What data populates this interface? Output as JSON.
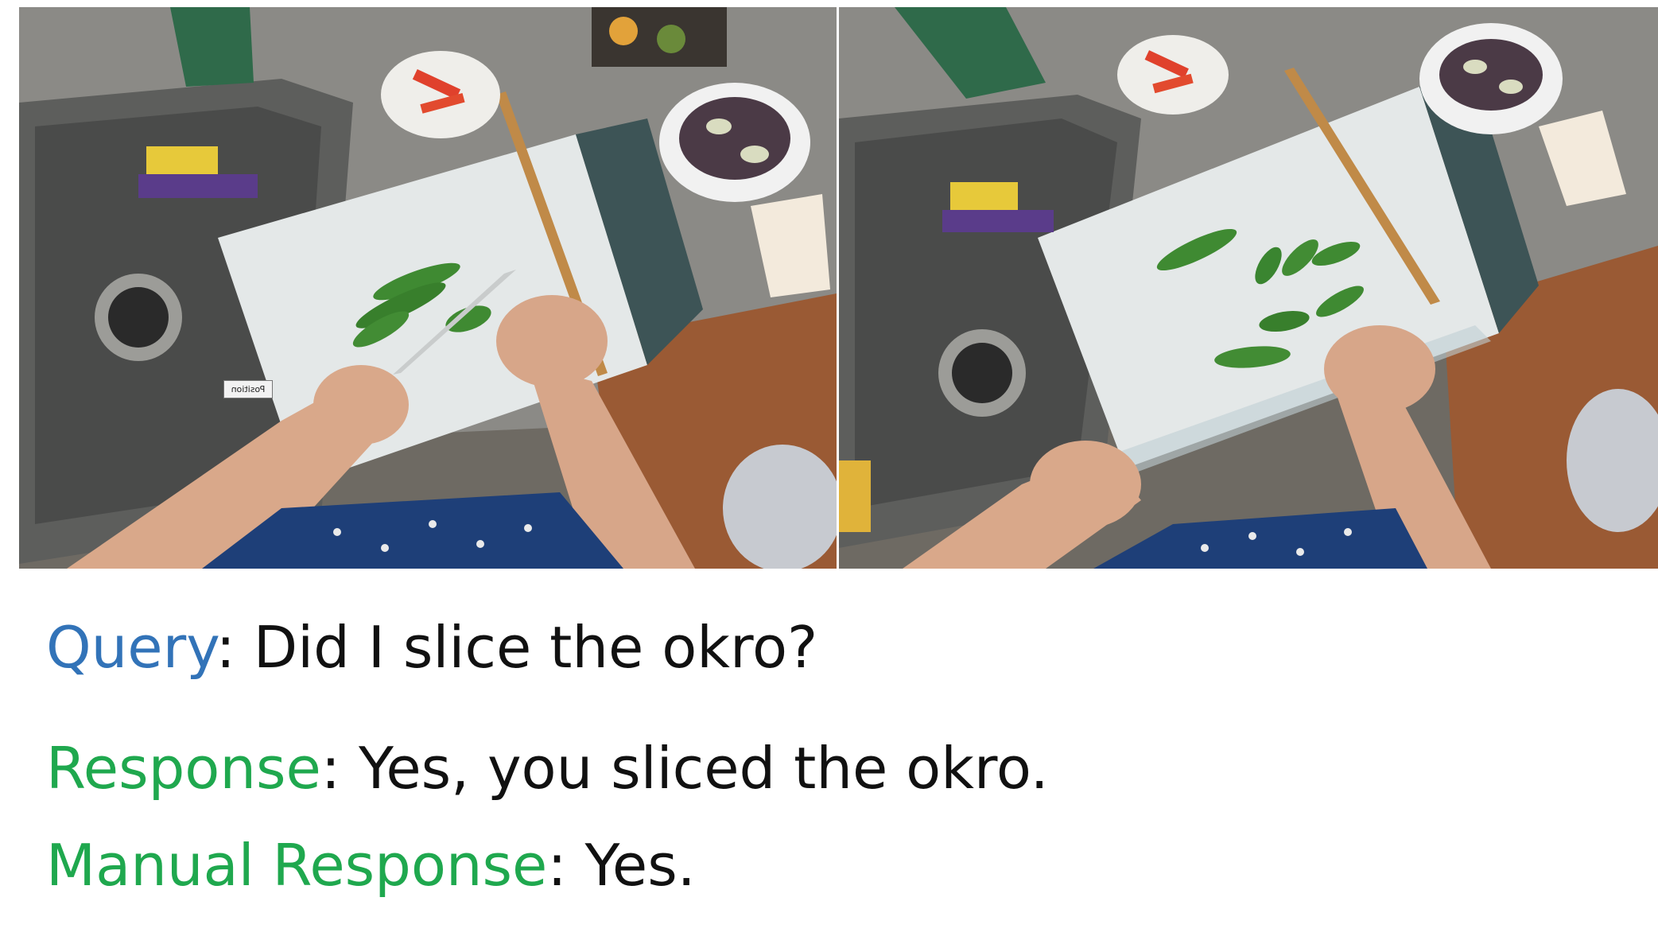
{
  "frames": {
    "left": {
      "overlay_label": "Position"
    }
  },
  "qa": {
    "query_label": "Query",
    "query_text": ": Did I slice the okro?",
    "response_label": "Response",
    "response_text": ": Yes, you sliced the okro.",
    "manual_label": "Manual Response",
    "manual_text": ": Yes."
  },
  "colors": {
    "query_label": "#3273b8",
    "response_label": "#1fa84e",
    "text": "#111111"
  }
}
